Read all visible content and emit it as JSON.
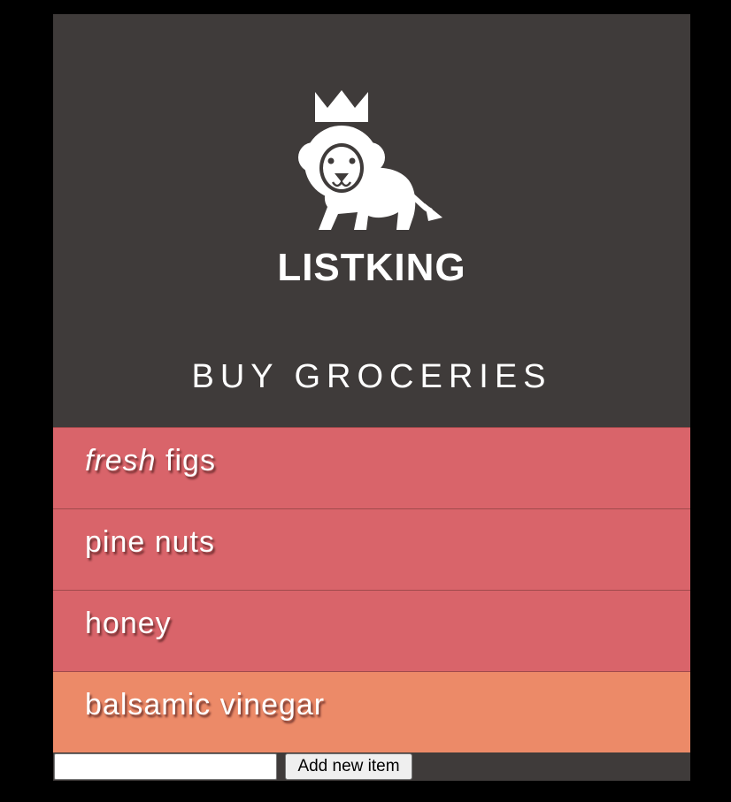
{
  "brand": {
    "name": "LISTKING",
    "logo_icon": "lion-king-logo-icon"
  },
  "list": {
    "title": "BUY GROCERIES",
    "items": [
      {
        "emphasis": "fresh",
        "text": " figs",
        "color": "#d9646a"
      },
      {
        "emphasis": "",
        "text": "pine nuts",
        "color": "#d9646a"
      },
      {
        "emphasis": "",
        "text": "honey",
        "color": "#d9646a"
      },
      {
        "emphasis": "",
        "text": "balsamic vinegar",
        "color": "#ec8a68"
      }
    ]
  },
  "add_form": {
    "input_value": "",
    "input_placeholder": "",
    "button_label": "Add new item"
  },
  "colors": {
    "page_background": "#000000",
    "header_background": "#3f3b3a",
    "item_red": "#d9646a",
    "item_orange": "#ec8a68",
    "text": "#ffffff"
  }
}
